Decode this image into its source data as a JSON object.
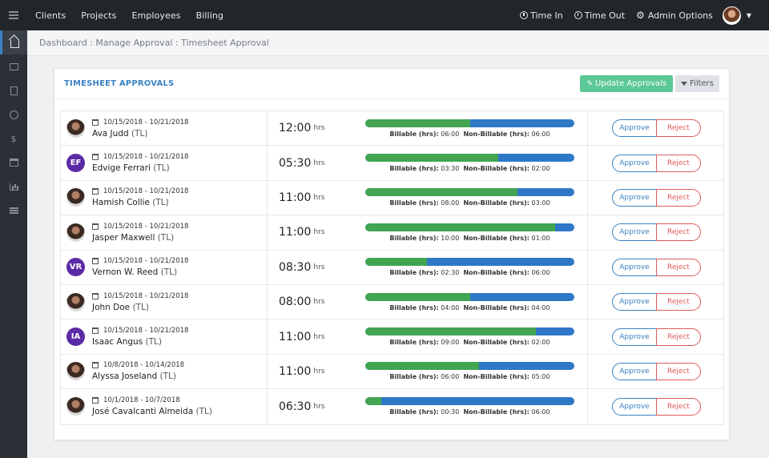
{
  "nav": {
    "items": [
      "Clients",
      "Projects",
      "Employees",
      "Billing"
    ]
  },
  "header_right": {
    "time_in": "Time In",
    "time_out": "Time Out",
    "admin_options": "Admin Options"
  },
  "breadcrumb": "Dashboard : Manage Approval : Timesheet Approval",
  "card": {
    "title": "TIMESHEET APPROVALS",
    "update_button": "Update Approvals",
    "filters_button": "Filters"
  },
  "labels": {
    "hrs_unit": "hrs",
    "billable": "Billable (hrs):",
    "non_billable": "Non-Billable (hrs):",
    "approve": "Approve",
    "reject": "Reject",
    "tl": "(TL)"
  },
  "colors": {
    "billable": "#43a452",
    "non_billable": "#2f78c8",
    "approve": "#3b82c4",
    "reject": "#e05a5a",
    "update": "#5bc896"
  },
  "rows": [
    {
      "avatar": "photo",
      "initials": "",
      "date_range": "10/15/2018 - 10/21/2018",
      "name": "Ava Judd",
      "hours": "12:00",
      "billable": "06:00",
      "non_billable": "06:00",
      "billable_ratio": 0.5
    },
    {
      "avatar": "initials",
      "initials": "EF",
      "date_range": "10/15/2018 - 10/21/2018",
      "name": "Edvige Ferrari",
      "hours": "05:30",
      "billable": "03:30",
      "non_billable": "02:00",
      "billable_ratio": 0.636
    },
    {
      "avatar": "photo",
      "initials": "",
      "date_range": "10/15/2018 - 10/21/2018",
      "name": "Hamish Collie",
      "hours": "11:00",
      "billable": "08:00",
      "non_billable": "03:00",
      "billable_ratio": 0.727
    },
    {
      "avatar": "photo",
      "initials": "",
      "date_range": "10/15/2018 - 10/21/2018",
      "name": "Jasper Maxwell",
      "hours": "11:00",
      "billable": "10:00",
      "non_billable": "01:00",
      "billable_ratio": 0.909
    },
    {
      "avatar": "initials",
      "initials": "VR",
      "date_range": "10/15/2018 - 10/21/2018",
      "name": "Vernon W. Reed",
      "hours": "08:30",
      "billable": "02:30",
      "non_billable": "06:00",
      "billable_ratio": 0.294
    },
    {
      "avatar": "photo",
      "initials": "",
      "date_range": "10/15/2018 - 10/21/2018",
      "name": "John Doe",
      "hours": "08:00",
      "billable": "04:00",
      "non_billable": "04:00",
      "billable_ratio": 0.5
    },
    {
      "avatar": "initials",
      "initials": "IA",
      "date_range": "10/15/2018 - 10/21/2018",
      "name": "Isaac Angus",
      "hours": "11:00",
      "billable": "09:00",
      "non_billable": "02:00",
      "billable_ratio": 0.818
    },
    {
      "avatar": "photo",
      "initials": "",
      "date_range": "10/8/2018 - 10/14/2018",
      "name": "Alyssa Joseland",
      "hours": "11:00",
      "billable": "06:00",
      "non_billable": "05:00",
      "billable_ratio": 0.545
    },
    {
      "avatar": "photo",
      "initials": "",
      "date_range": "10/1/2018 - 10/7/2018",
      "name": "José Cavalcanti Almeida",
      "hours": "06:30",
      "billable": "00:30",
      "non_billable": "06:00",
      "billable_ratio": 0.077
    }
  ]
}
